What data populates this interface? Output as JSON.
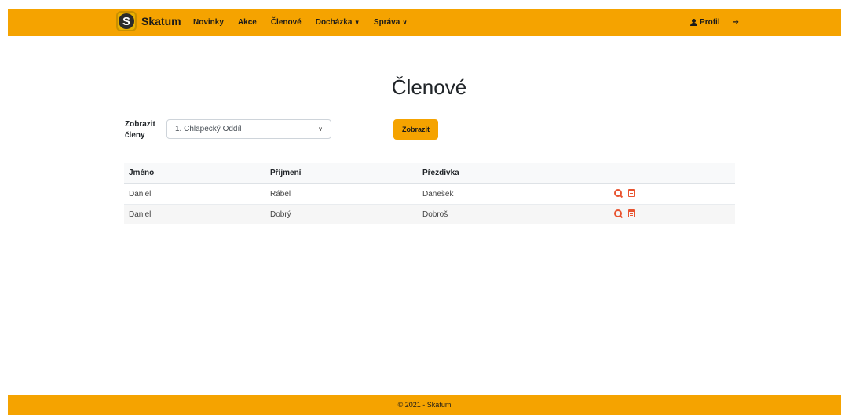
{
  "navbar": {
    "brand": "Skatum",
    "logo_letter": "S",
    "links": [
      {
        "label": "Novinky"
      },
      {
        "label": "Akce"
      },
      {
        "label": "Členové"
      },
      {
        "label": "Docházka",
        "dropdown": true
      },
      {
        "label": "Správa",
        "dropdown": true
      }
    ],
    "profile_label": "Profil",
    "logout_icon": "sign-out-icon",
    "color": "#f5a300"
  },
  "page": {
    "title": "Členové"
  },
  "filter": {
    "label": "Zobrazit členy",
    "selected_option": "1. Chlapecký Oddíl",
    "button_label": "Zobrazit"
  },
  "table": {
    "columns": [
      "Jméno",
      "Příjmení",
      "Přezdívka",
      ""
    ],
    "rows": [
      {
        "first": "Daniel",
        "last": "Rábel",
        "nickname": "Danešek"
      },
      {
        "first": "Daniel",
        "last": "Dobrý",
        "nickname": "Dobroš"
      }
    ],
    "action_icons": [
      "search-icon",
      "calendar-icon"
    ],
    "action_color": "#e8532f"
  },
  "footer": {
    "text": "© 2021 - Skatum"
  }
}
